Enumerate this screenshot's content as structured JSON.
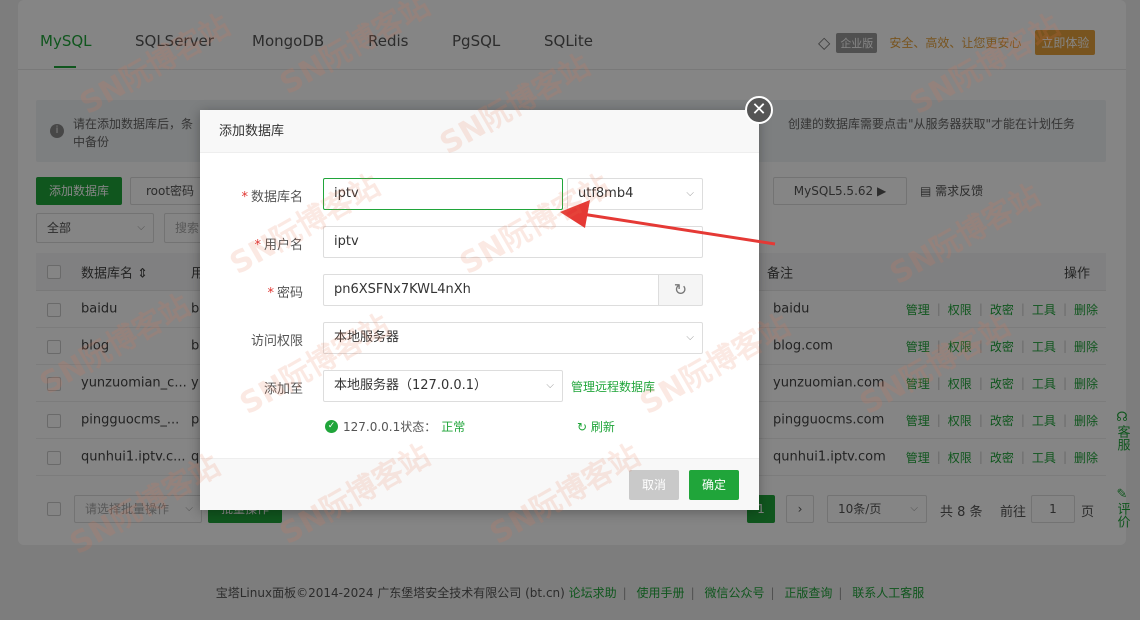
{
  "tabs": [
    "MySQL",
    "SQLServer",
    "MongoDB",
    "Redis",
    "PgSQL",
    "SQLite"
  ],
  "enterprise": {
    "badge": "企业版",
    "slogan": "安全、高效、让您更安心",
    "try_label": "立即体验"
  },
  "tip": {
    "line1": "请在添加数据库后，条",
    "line1_right": "创建的数据库需要点击\"从服务器获取\"才能在计划任务",
    "line2": "中备份"
  },
  "toolbar": {
    "add_db": "添加数据库",
    "root_pwd": "root密码",
    "mysql_version": "MySQL5.5.62 ▶",
    "feedback": "需求反馈",
    "filter_all": "全部",
    "search_placeholder": "搜索"
  },
  "table": {
    "headers": {
      "name": "数据库名",
      "user": "用",
      "remark": "备注",
      "ops": "操作"
    },
    "rows": [
      {
        "name": "baidu",
        "user": "b",
        "remark": "baidu"
      },
      {
        "name": "blog",
        "user": "b",
        "remark": "blog.com"
      },
      {
        "name": "yunzuomian_c...",
        "user": "y",
        "remark": "yunzuomian.com"
      },
      {
        "name": "pingguocms_...",
        "user": "p",
        "remark": "pingguocms.com"
      },
      {
        "name": "qunhui1.iptv.c...",
        "user": "q",
        "remark": "qunhui1.iptv.com"
      }
    ],
    "ops": [
      "管理",
      "权限",
      "改密",
      "工具",
      "删除"
    ]
  },
  "pagination": {
    "batch_placeholder": "请选择批量操作",
    "batch_btn": "批量操作",
    "per_page": "10条/页",
    "total": "共 8 条",
    "goto": "前往",
    "page": "1",
    "page_suffix": "页"
  },
  "sidebar": {
    "service": "客服",
    "review": "评价"
  },
  "footer": {
    "copyright": "宝塔Linux面板©2014-2024 广东堡塔安全技术有限公司 (bt.cn)",
    "links": [
      "论坛求助",
      "使用手册",
      "微信公众号",
      "正版查询",
      "联系人工客服"
    ]
  },
  "modal": {
    "title": "添加数据库",
    "fields": {
      "db_name_label": "数据库名",
      "db_name_value": "iptv",
      "charset_value": "utf8mb4",
      "username_label": "用户名",
      "username_value": "iptv",
      "password_label": "密码",
      "password_value": "pn6XSFNx7KWL4nXh",
      "access_label": "访问权限",
      "access_value": "本地服务器",
      "add_to_label": "添加至",
      "add_to_value": "本地服务器（127.0.0.1）",
      "remote_link": "管理远程数据库"
    },
    "status": {
      "host": "127.0.0.1状态：",
      "state": "正常",
      "refresh": "刷新"
    },
    "cancel": "取消",
    "confirm": "确定"
  },
  "watermark": "SN阮博客站",
  "colors": {
    "accent": "#20a53a",
    "warning": "#e6a23c",
    "danger": "#e0322e",
    "arrow": "#e53935"
  }
}
